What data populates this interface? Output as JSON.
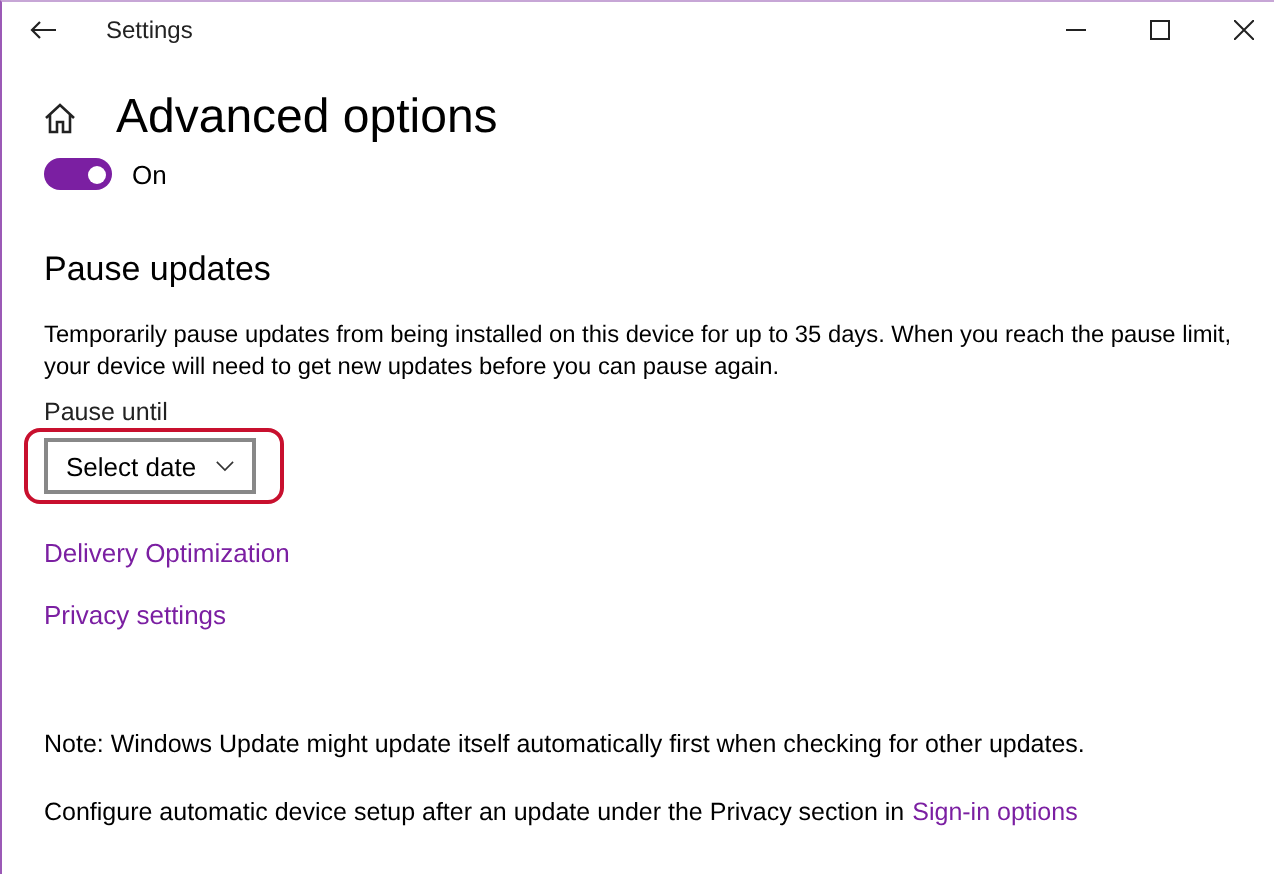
{
  "window": {
    "title": "Settings"
  },
  "page": {
    "title": "Advanced options"
  },
  "toggle": {
    "on": true,
    "label": "On"
  },
  "pause_updates": {
    "heading": "Pause updates",
    "description": "Temporarily pause updates from being installed on this device for up to 35 days. When you reach the pause limit, your device will need to get new updates before you can pause again.",
    "field_label": "Pause until",
    "dropdown": {
      "value": "Select date",
      "highlighted": true
    }
  },
  "links": [
    "Delivery Optimization",
    "Privacy settings"
  ],
  "note": "Note: Windows Update might update itself automatically first when checking for other updates.",
  "footer": {
    "text": "Configure automatic device setup after an update under the Privacy section in",
    "link": "Sign-in options"
  }
}
